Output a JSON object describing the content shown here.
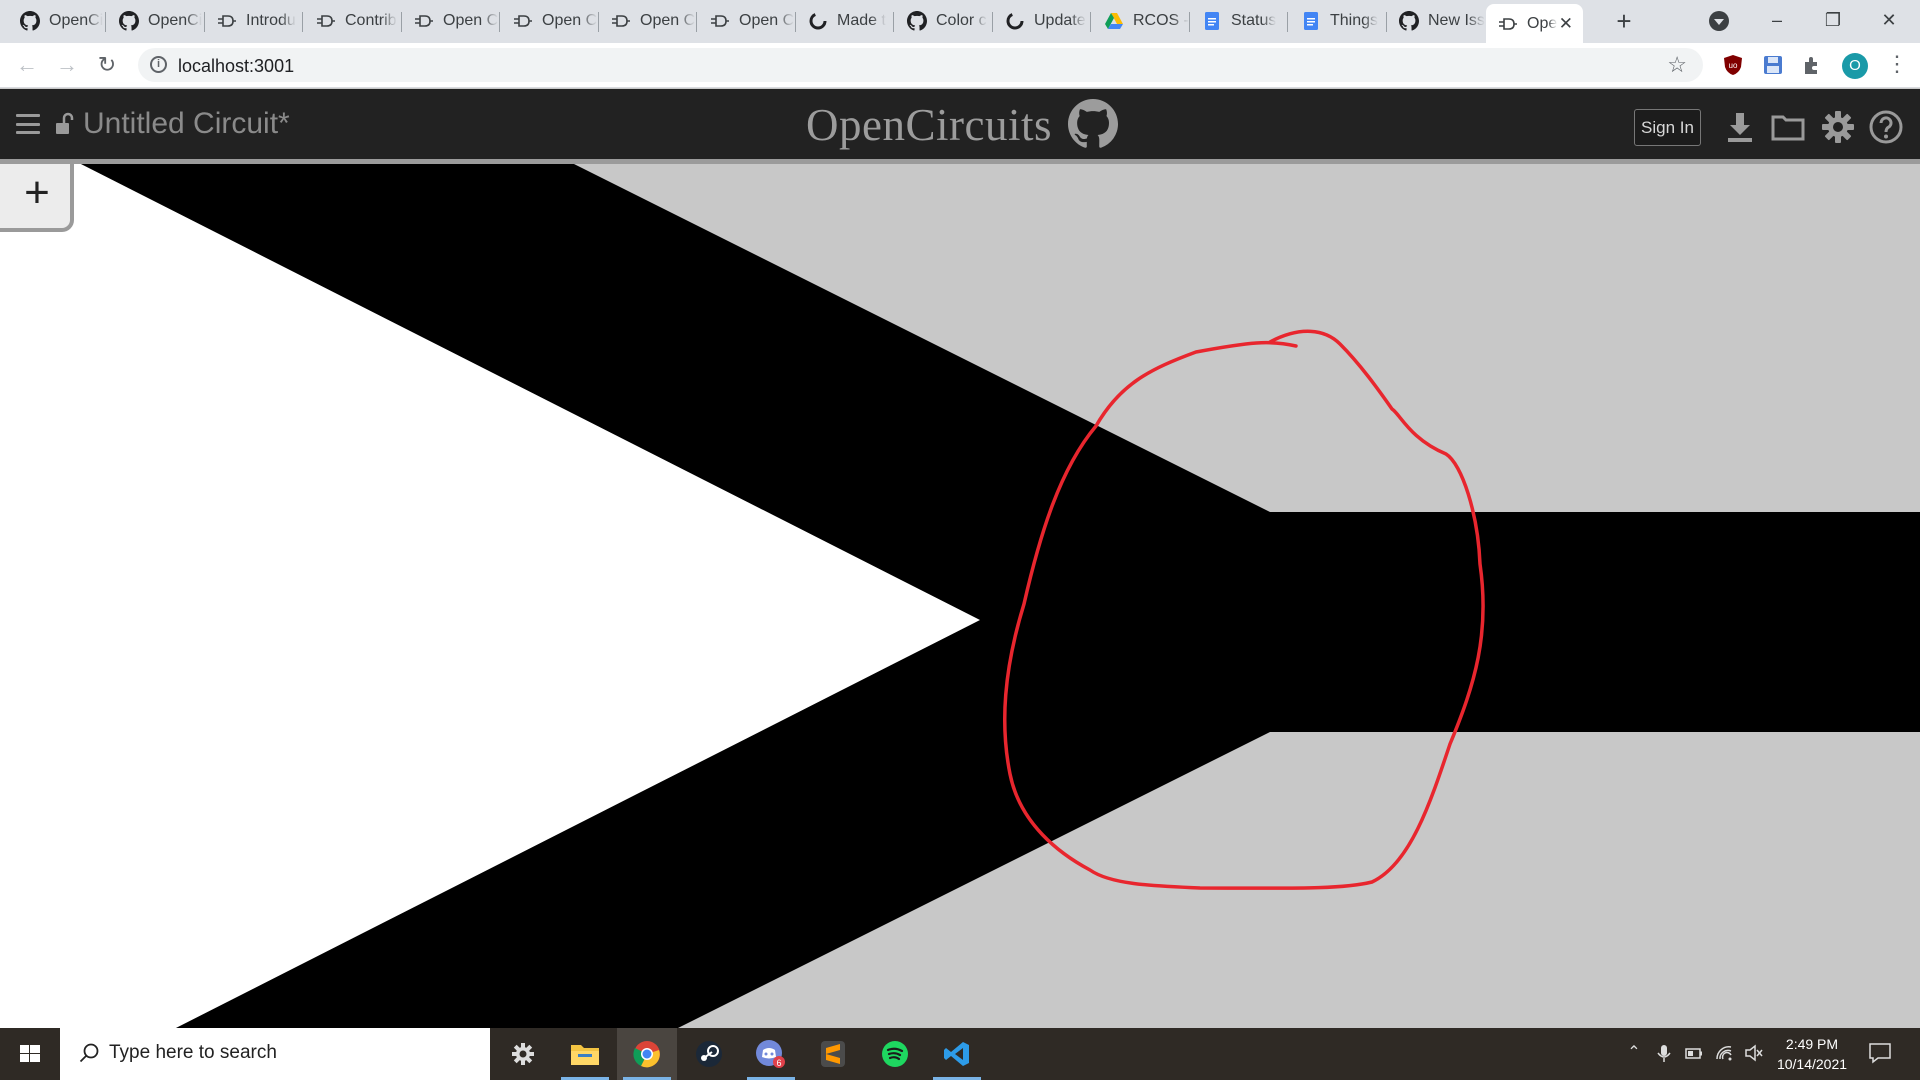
{
  "browser": {
    "tabs": [
      {
        "title": "OpenCi",
        "favicon": "github-icon"
      },
      {
        "title": "OpenCi",
        "favicon": "github-icon"
      },
      {
        "title": "Introdu",
        "favicon": "opencircuits-icon"
      },
      {
        "title": "Contrib",
        "favicon": "opencircuits-icon"
      },
      {
        "title": "Open C",
        "favicon": "opencircuits-icon"
      },
      {
        "title": "Open C",
        "favicon": "opencircuits-icon"
      },
      {
        "title": "Open C",
        "favicon": "opencircuits-icon"
      },
      {
        "title": "Open C",
        "favicon": "opencircuits-icon"
      },
      {
        "title": "Made t",
        "favicon": "github-loading-icon"
      },
      {
        "title": "Color c",
        "favicon": "github-icon"
      },
      {
        "title": "Update",
        "favicon": "github-loading-icon"
      },
      {
        "title": "RCOS -",
        "favicon": "google-drive-icon"
      },
      {
        "title": "Status",
        "favicon": "google-docs-icon"
      },
      {
        "title": "Things",
        "favicon": "google-docs-icon"
      },
      {
        "title": "New Iss",
        "favicon": "github-icon"
      },
      {
        "title": "Ope",
        "favicon": "opencircuits-icon",
        "active": true
      }
    ],
    "new_tab": "+",
    "url": "localhost:3001"
  },
  "app": {
    "circuit_name": "Untitled Circuit*",
    "logo": "OpenCircuits",
    "sign_in": "Sign In",
    "add_button": "+",
    "canvas": {
      "background": "#c8c8c8",
      "gate_fill": "#ffffff",
      "gate_outline": "#000000",
      "annotation_color": "#e8262e"
    }
  },
  "taskbar": {
    "search_placeholder": "Type here to search",
    "time": "2:49 PM",
    "date": "10/14/2021",
    "discord_badge": "6"
  }
}
